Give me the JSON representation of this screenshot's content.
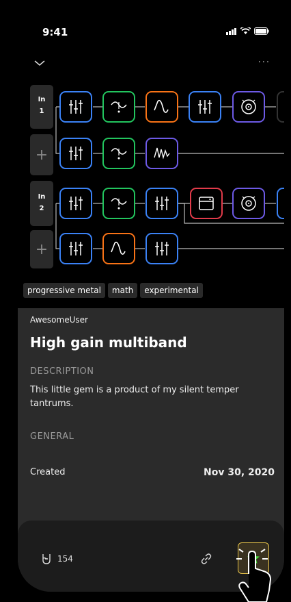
{
  "status": {
    "time": "9:41"
  },
  "chain": {
    "input1_label": "In",
    "input1_num": "1",
    "input2_label": "In",
    "input2_num": "2",
    "add_label": "+",
    "colors": {
      "blue": "#3b82f6",
      "green": "#22c55e",
      "orange": "#f97316",
      "purple": "#6d5ae6",
      "red": "#e23b4a"
    }
  },
  "tags": [
    "progressive metal",
    "math",
    "experimental"
  ],
  "preset": {
    "user": "AwesomeUser",
    "title": "High gain multiband",
    "description_header": "DESCRIPTION",
    "description": "This little gem is a product of my silent temper tantrums.",
    "general_header": "GENERAL",
    "created_label": "Created",
    "created_value": "Nov 30, 2020"
  },
  "footer": {
    "likes": "154"
  }
}
